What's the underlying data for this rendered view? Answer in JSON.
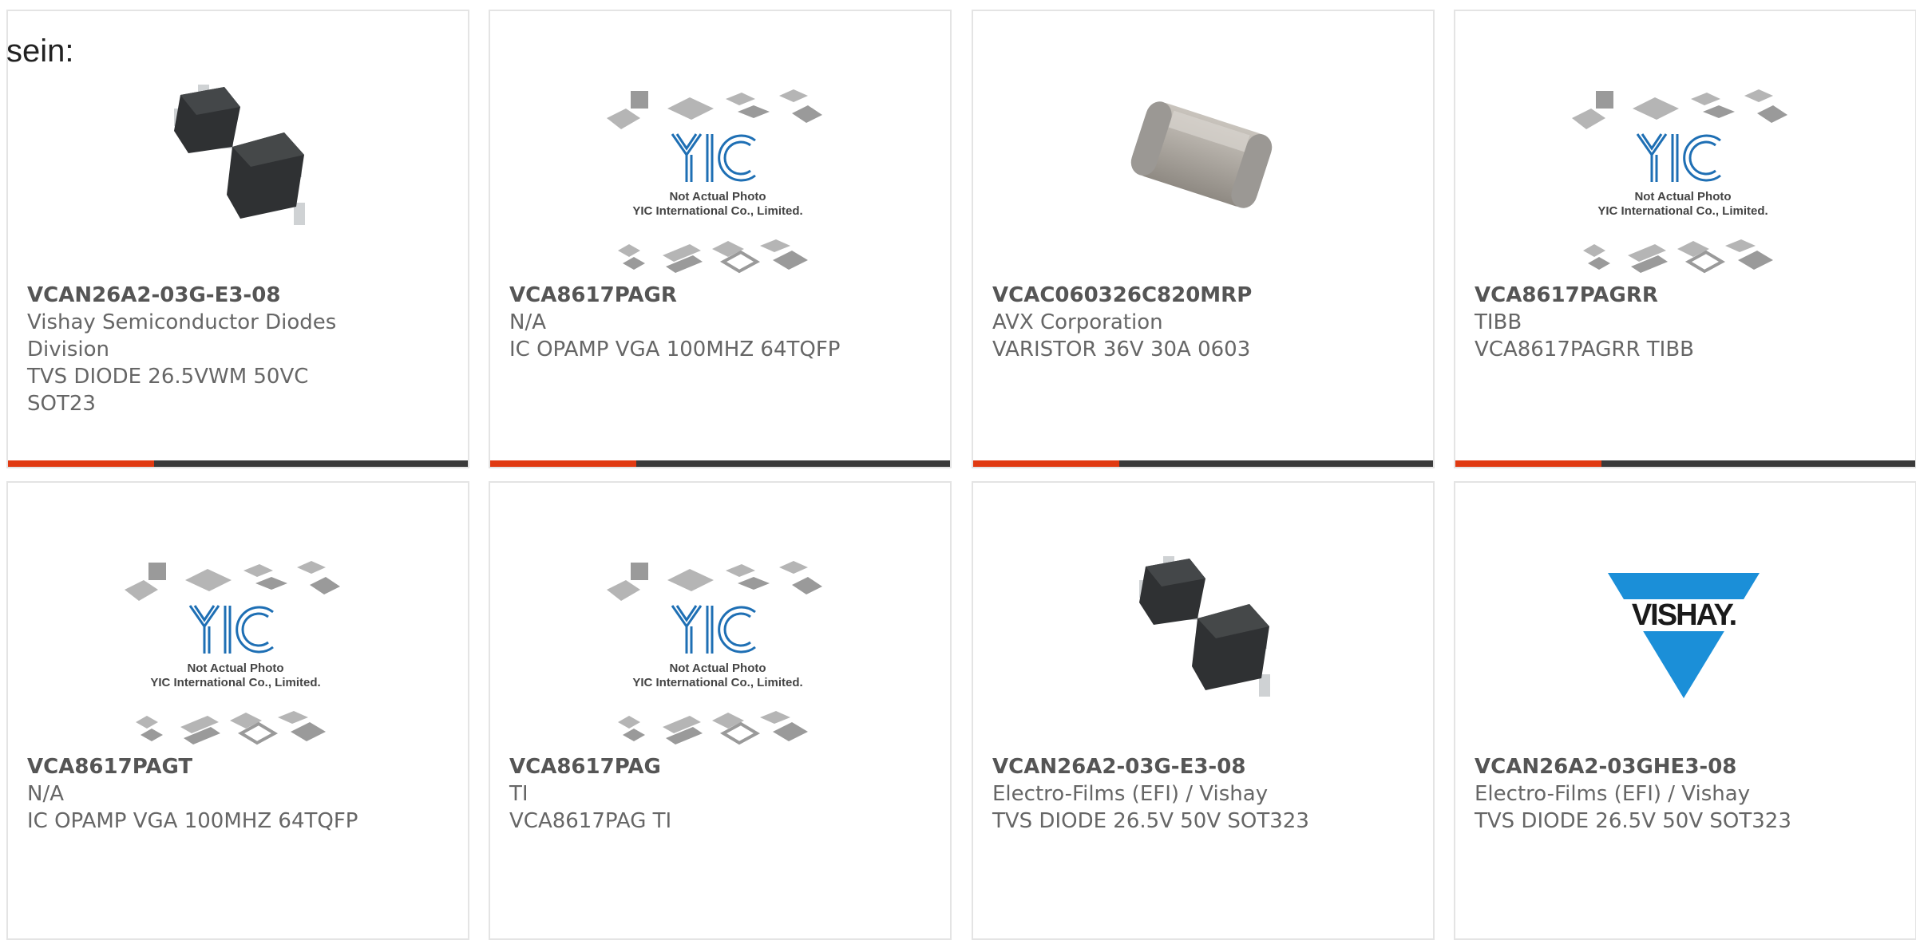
{
  "intro_text": "sein:",
  "colors": {
    "accent": "#e03a12",
    "bar": "#3a3a3a",
    "yic_blue": "#1e6fb4",
    "vishay_blue": "#1b8fd8"
  },
  "placeholder": {
    "line1": "Not Actual Photo",
    "line2": "YIC International Co., Limited."
  },
  "vishay_logo_text": "VISHAY.",
  "products": [
    {
      "part": "VCAN26A2-03G-E3-08",
      "manufacturer": "Vishay Semiconductor Diodes Division",
      "description": "TVS DIODE 26.5VWM 50VC SOT23",
      "image": "sot23-package",
      "hover": true
    },
    {
      "part": "VCA8617PAGR",
      "manufacturer": "N/A",
      "description": "IC OPAMP VGA 100MHZ 64TQFP",
      "image": "yic-placeholder",
      "hover": true
    },
    {
      "part": "VCAC060326C820MRP",
      "manufacturer": "AVX Corporation",
      "description": "VARISTOR 36V 30A 0603",
      "image": "chip-0603",
      "hover": true
    },
    {
      "part": "VCA8617PAGRR",
      "manufacturer": "TIBB",
      "description": "VCA8617PAGRR TIBB",
      "image": "yic-placeholder",
      "hover": true
    },
    {
      "part": "VCA8617PAGT",
      "manufacturer": "N/A",
      "description": "IC OPAMP VGA 100MHZ 64TQFP",
      "image": "yic-placeholder",
      "hover": false
    },
    {
      "part": "VCA8617PAG",
      "manufacturer": "TI",
      "description": "VCA8617PAG TI",
      "image": "yic-placeholder",
      "hover": false
    },
    {
      "part": "VCAN26A2-03G-E3-08",
      "manufacturer": "Electro-Films (EFI) / Vishay",
      "description": "TVS DIODE 26.5V 50V SOT323",
      "image": "sot23-package",
      "hover": false
    },
    {
      "part": "VCAN26A2-03GHE3-08",
      "manufacturer": "Electro-Films (EFI) / Vishay",
      "description": "TVS DIODE 26.5V 50V SOT323",
      "image": "vishay-logo",
      "hover": false
    }
  ]
}
